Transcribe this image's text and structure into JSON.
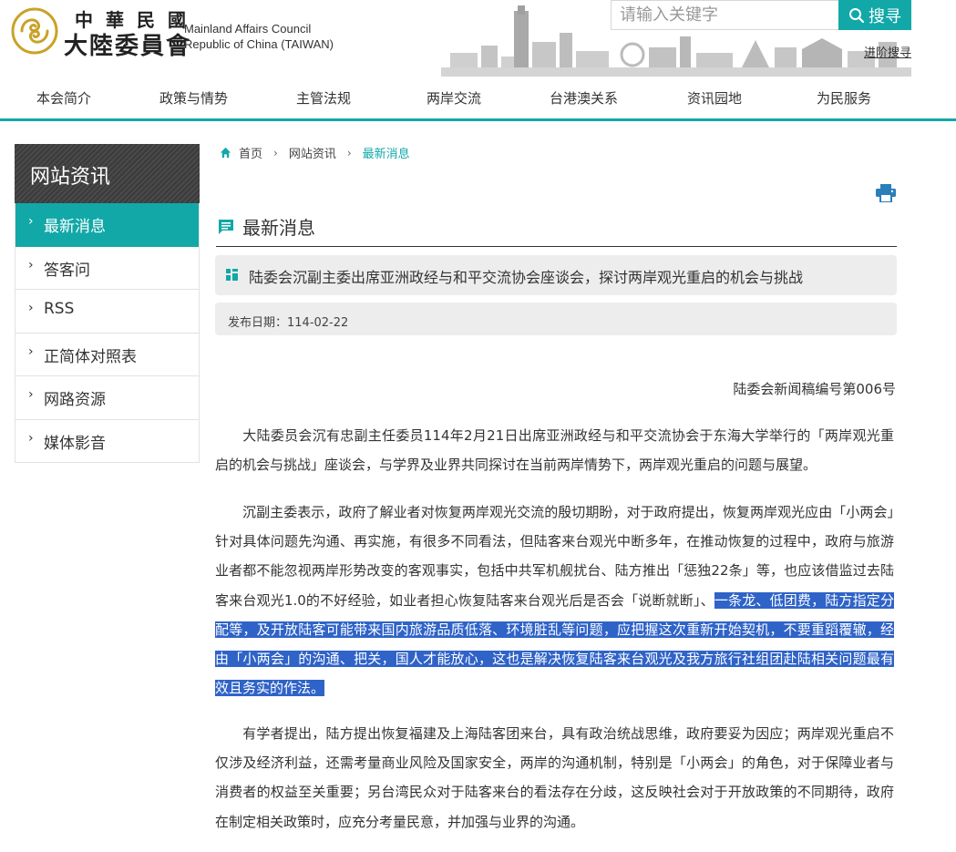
{
  "header": {
    "logo_zh_top": "中華民國",
    "logo_zh_bottom": "大陸委員會",
    "logo_en_line1": "Mainland Affairs Council",
    "logo_en_line2": "Republic of China (TAIWAN)",
    "search_placeholder": "请输入关键字",
    "search_button": "搜寻",
    "advanced_search": "进阶搜寻"
  },
  "nav": {
    "items": [
      "本会简介",
      "政策与情势",
      "主管法规",
      "两岸交流",
      "台港澳关系",
      "资讯园地",
      "为民服务"
    ]
  },
  "sidebar": {
    "title": "网站资讯",
    "items": [
      {
        "label": "最新消息",
        "active": true
      },
      {
        "label": "答客问"
      },
      {
        "label": "RSS"
      },
      {
        "label": "正简体对照表"
      },
      {
        "label": "网路资源"
      },
      {
        "label": "媒体影音"
      }
    ]
  },
  "breadcrumb": {
    "home": "首页",
    "level1": "网站资讯",
    "current": "最新消息"
  },
  "section": {
    "title": "最新消息"
  },
  "article": {
    "headline": "陆委会沉副主委出席亚洲政经与和平交流协会座谈会，探讨两岸观光重启的机会与挑战",
    "date": "发布日期：114-02-22",
    "press_number": "陆委会新闻稿编号第006号",
    "p1": "大陆委员会沉有忠副主任委员114年2月21日出席亚洲政经与和平交流协会于东海大学举行的「两岸观光重启的机会与挑战」座谈会，与学界及业界共同探讨在当前两岸情势下，两岸观光重启的问题与展望。",
    "p2_plain": "沉副主委表示，政府了解业者对恢复两岸观光交流的殷切期盼，对于政府提出，恢复两岸观光应由「小两会」针对具体问题先沟通、再实施，有很多不同看法，但陆客来台观光中断多年，在推动恢复的过程中，政府与旅游业者都不能忽视两岸形势改变的客观事实，包括中共军机舰扰台、陆方推出「惩独22条」等，也应该借监过去陆客来台观光1.0的不好经验，如业者担心恢复陆客来台观光后是否会「说断就断」、",
    "p2_highlight": "一条龙、低团费，陆方指定分配等，及开放陆客可能带来国内旅游品质低落、环境脏乱等问题，应把握这次重新开始契机，不要重蹈覆辙，经由「小两会」的沟通、把关，国人才能放心，这也是解决恢复陆客来台观光及我方旅行社组团赴陆相关问题最有效且务实的作法。",
    "p3": "有学者提出，陆方提出恢复福建及上海陆客团来台，具有政治统战思维，政府要妥为因应；两岸观光重启不仅涉及经济利益，还需考量商业风险及国家安全，两岸的沟通机制，特别是「小两会」的角色，对于保障业者与消费者的权益至关重要；另台湾民众对于陆客来台的看法存在分歧，这反映社会对于开放政策的不同期待，政府在制定相关政策时，应充分考量民意，并加强与业界的沟通。"
  },
  "colors": {
    "accent": "#12a8a8",
    "highlight": "#2f63c8",
    "sidebar_title_bg": "#444444"
  }
}
